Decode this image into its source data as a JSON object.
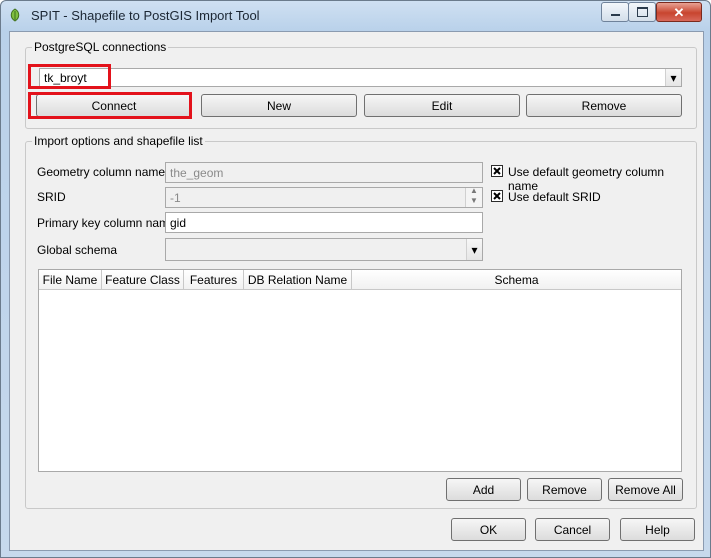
{
  "window": {
    "title": "SPIT - Shapefile to PostGIS Import Tool",
    "icons": {
      "app": "qgis-leaf-icon",
      "minimize": "minimize-icon",
      "maximize": "maximize-icon",
      "close": "close-icon"
    }
  },
  "connections": {
    "group_title": "PostgreSQL connections",
    "selected": "tk_broyt",
    "buttons": {
      "connect": "Connect",
      "new": "New",
      "edit": "Edit",
      "remove": "Remove"
    }
  },
  "import": {
    "group_title": "Import options and shapefile list",
    "geometry_column": {
      "label": "Geometry column name",
      "value": "the_geom"
    },
    "use_default_geometry": {
      "label": "Use default geometry column name",
      "checked": true
    },
    "srid": {
      "label": "SRID",
      "value": "-1"
    },
    "use_default_srid": {
      "label": "Use default SRID",
      "checked": true
    },
    "primary_key": {
      "label": "Primary key column name",
      "value": "gid"
    },
    "global_schema": {
      "label": "Global schema",
      "value": ""
    },
    "table": {
      "columns": [
        "File Name",
        "Feature Class",
        "Features",
        "DB Relation Name",
        "Schema"
      ],
      "rows": []
    },
    "buttons": {
      "add": "Add",
      "remove": "Remove",
      "remove_all": "Remove All"
    }
  },
  "footer": {
    "ok": "OK",
    "cancel": "Cancel",
    "help": "Help"
  },
  "colors": {
    "highlight": "#e3121b",
    "close_button": "#c8452f"
  }
}
